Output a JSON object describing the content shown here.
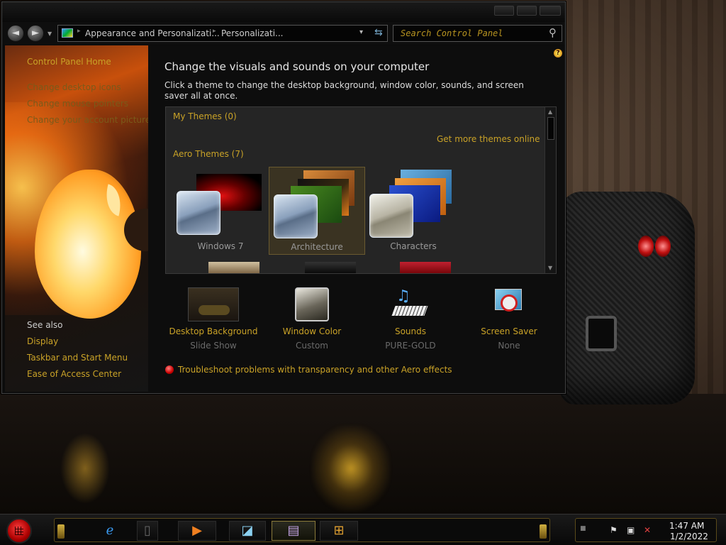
{
  "nav": {
    "back_glyph": "◄",
    "forward_glyph": "►",
    "dropdown_glyph": "▼"
  },
  "address": {
    "crumbs": [
      "Appearance and Personalizati...",
      "Personalizati..."
    ],
    "separator": "▸",
    "dropdown_glyph": "▾",
    "refresh_glyph": "⇆"
  },
  "search": {
    "placeholder": "Search Control Panel",
    "icon": "search-icon"
  },
  "sidebar": {
    "home": "Control Panel Home",
    "tasks": [
      "Change desktop icons",
      "Change mouse pointers",
      "Change your account picture"
    ],
    "see_also_heading": "See also",
    "see_also": [
      "Display",
      "Taskbar and Start Menu",
      "Ease of Access Center"
    ]
  },
  "main": {
    "heading": "Change the visuals and sounds on your computer",
    "subtext": "Click a theme to change the desktop background, window color, sounds, and screen saver all at once.",
    "help_glyph": "?",
    "themes": {
      "my_themes": "My Themes (0)",
      "get_more": "Get more themes online",
      "aero_themes": "Aero Themes (7)",
      "items": [
        {
          "name": "Windows 7",
          "selected": false
        },
        {
          "name": "Architecture",
          "selected": true
        },
        {
          "name": "Characters",
          "selected": false
        }
      ]
    },
    "options": [
      {
        "label": "Desktop Background",
        "value": "Slide Show",
        "icon": "desktop-background-icon"
      },
      {
        "label": "Window Color",
        "value": "Custom",
        "icon": "window-color-icon"
      },
      {
        "label": "Sounds",
        "value": "PURE-GOLD",
        "icon": "sounds-icon"
      },
      {
        "label": "Screen Saver",
        "value": "None",
        "icon": "screen-saver-icon"
      }
    ],
    "troubleshoot": "Troubleshoot problems with transparency and other Aero effects"
  },
  "taskbar": {
    "items": [
      "internet-explorer-icon",
      "blank-window-icon",
      "media-player-icon",
      "windows-explorer-icon",
      "control-panel-icon",
      "windows-logo-icon"
    ],
    "active_index": 4,
    "clock_time": "1:47 AM",
    "clock_date": "1/2/2022"
  },
  "colors": {
    "accent_gold": "#c9a227",
    "window_bg": "#0d0d0d"
  }
}
